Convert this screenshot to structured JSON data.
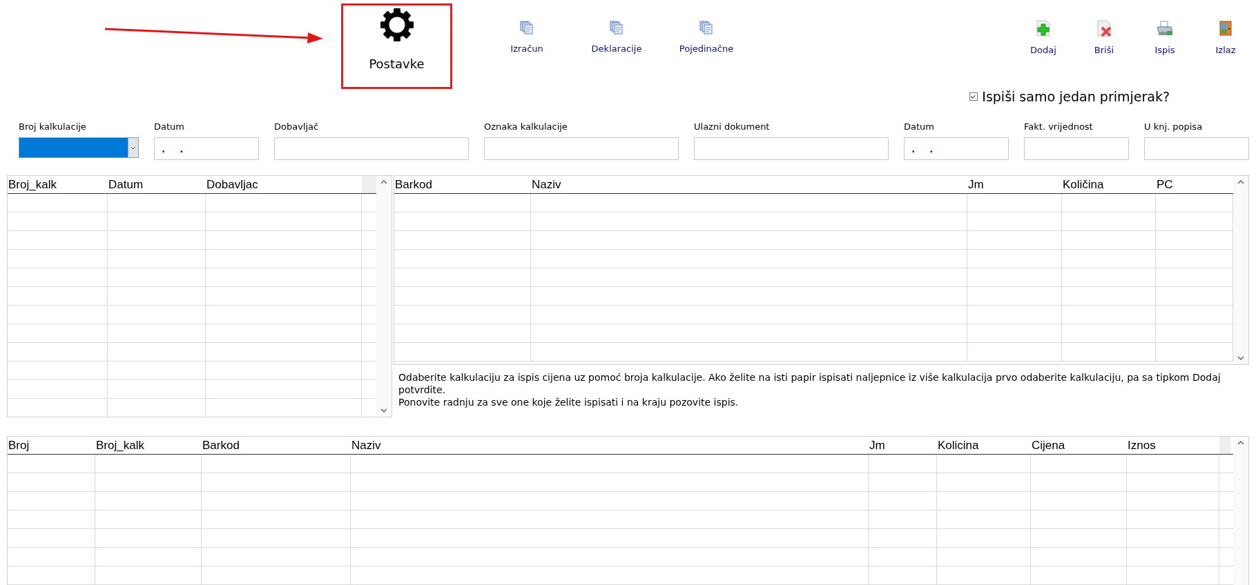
{
  "toolbar": {
    "buttons": [
      {
        "label": "Postavke",
        "kind": "gear",
        "highlighted": true
      },
      {
        "label": "Izračun",
        "kind": "documents",
        "highlighted": false
      },
      {
        "label": "Deklaracije",
        "kind": "documents",
        "highlighted": false
      },
      {
        "label": "Pojedinačne",
        "kind": "documents",
        "highlighted": false
      },
      {
        "label": "Dodaj",
        "kind": "add",
        "highlighted": false
      },
      {
        "label": "Briši",
        "kind": "delete",
        "highlighted": false
      },
      {
        "label": "Ispis",
        "kind": "print",
        "highlighted": false
      },
      {
        "label": "Izlaz",
        "kind": "exit",
        "highlighted": false
      }
    ]
  },
  "print_one_copy": {
    "label": "Ispiši samo jedan primjerak?",
    "checked": true
  },
  "form": {
    "fields": [
      {
        "label": "Broj kalkulacije",
        "kind": "combo",
        "highlighted": true
      },
      {
        "label": "Datum",
        "kind": "date",
        "value": ". ."
      },
      {
        "label": "Dobavljač",
        "kind": "text"
      },
      {
        "label": "Oznaka kalkulacije",
        "kind": "text"
      },
      {
        "label": "Ulazni dokument",
        "kind": "text"
      },
      {
        "label": "Datum",
        "kind": "date",
        "value": ". ."
      },
      {
        "label": "Fakt. vrijednost",
        "kind": "text"
      },
      {
        "label": "U knj. popisa",
        "kind": "text"
      }
    ]
  },
  "calculations_table": {
    "columns": [
      "Broj_kalk",
      "Datum",
      "Dobavljac"
    ]
  },
  "items_table": {
    "columns": [
      "Barkod",
      "Naziv",
      "Jm",
      "Količina",
      "PC"
    ]
  },
  "instructions": [
    "Odaberite kalkulaciju za ispis cijena uz pomoć broja kalkulacije. Ako želite na isti papir ispisati naljepnice iz više kalkulacija prvo odaberite kalkulaciju, pa sa tipkom Dodaj potvrdite.",
    "Ponovite radnju za sve one koje želite ispisati i na kraju pozovite ispis."
  ],
  "print_list_table": {
    "columns": [
      "Broj",
      "Broj_kalk",
      "Barkod",
      "Naziv",
      "Jm",
      "Kolicina",
      "Cijena",
      "Iznos"
    ]
  }
}
